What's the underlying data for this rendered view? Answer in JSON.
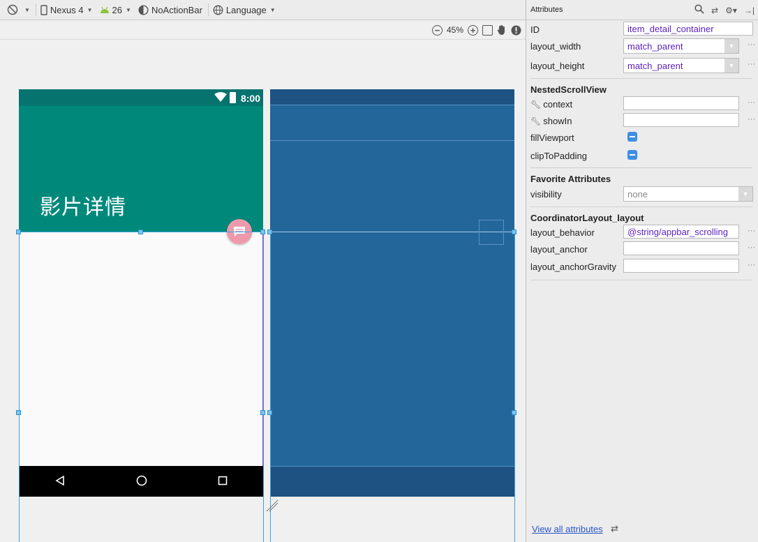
{
  "toolbar": {
    "device": "Nexus 4",
    "api_level": "26",
    "theme": "NoActionBar",
    "language": "Language"
  },
  "zoom": {
    "level": "45%"
  },
  "preview": {
    "status_time": "8:00",
    "app_title": "影片详情"
  },
  "attributes": {
    "panel_title": "Attributes",
    "id": {
      "label": "ID",
      "value": "item_detail_container"
    },
    "layout_width": {
      "label": "layout_width",
      "value": "match_parent"
    },
    "layout_height": {
      "label": "layout_height",
      "value": "match_parent"
    },
    "nested_section": "NestedScrollView",
    "context": {
      "label": "context",
      "value": ""
    },
    "showin": {
      "label": "showIn",
      "value": ""
    },
    "fill_viewport": {
      "label": "fillViewport"
    },
    "clip_to_padding": {
      "label": "clipToPadding"
    },
    "favorite_section": "Favorite Attributes",
    "visibility": {
      "label": "visibility",
      "value": "none"
    },
    "coordinator_section": "CoordinatorLayout_layout",
    "layout_behavior": {
      "label": "layout_behavior",
      "value": "@string/appbar_scrolling"
    },
    "layout_anchor": {
      "label": "layout_anchor",
      "value": ""
    },
    "layout_anchor_gravity": {
      "label": "layout_anchorGravity",
      "value": ""
    },
    "view_all": "View all attributes"
  },
  "colors": {
    "status_bar": "#06736f",
    "app_bar": "#00897b",
    "fab": "#ee9aac",
    "blueprint": "#23669a",
    "selection": "#3aa0e0"
  }
}
